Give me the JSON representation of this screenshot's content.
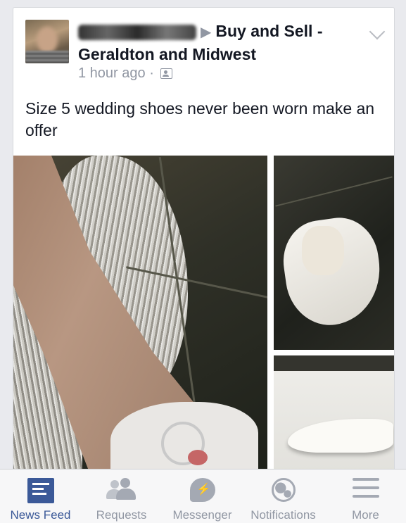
{
  "post": {
    "author_redacted": "",
    "arrow": "▶",
    "group_name": "Buy and Sell - Geraldton and Midwest",
    "timestamp": "1 hour ago",
    "separator": "·",
    "privacy_icon": "group-members-icon",
    "menu_icon": "chevron-down-icon",
    "text": "Size 5 wedding shoes never been worn make an offer",
    "photo_count": 3
  },
  "tabbar": {
    "items": [
      {
        "label": "News Feed",
        "icon": "news-feed-icon",
        "active": true
      },
      {
        "label": "Requests",
        "icon": "friend-requests-icon",
        "active": false
      },
      {
        "label": "Messenger",
        "icon": "messenger-icon",
        "active": false
      },
      {
        "label": "Notifications",
        "icon": "globe-icon",
        "active": false
      },
      {
        "label": "More",
        "icon": "hamburger-menu-icon",
        "active": false
      }
    ]
  },
  "colors": {
    "accent": "#3b5998",
    "inactive": "#9197a3",
    "background": "#e9eaee",
    "card": "#ffffff"
  }
}
